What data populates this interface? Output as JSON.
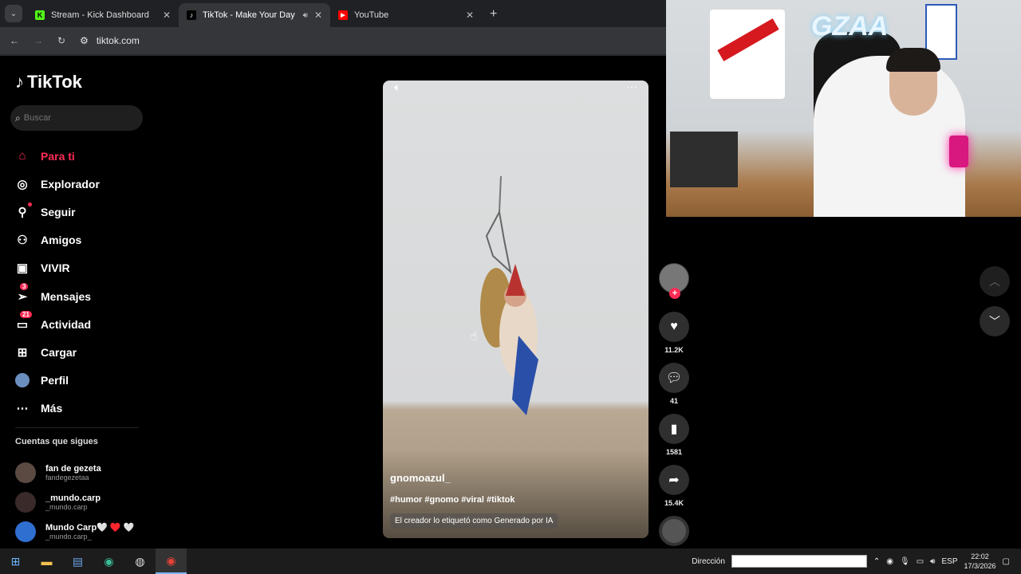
{
  "browser": {
    "tabs": [
      {
        "title": "Stream - Kick Dashboard",
        "favicon": "kick-icon",
        "active": false
      },
      {
        "title": "TikTok - Make Your Day",
        "favicon": "tiktok-icon",
        "active": true
      },
      {
        "title": "YouTube",
        "favicon": "youtube-icon",
        "active": false
      }
    ],
    "url": "tiktok.com"
  },
  "tiktok": {
    "logo_text": "TikTok",
    "search_placeholder": "Buscar",
    "nav": [
      {
        "label": "Para ti",
        "icon": "home-icon",
        "active": true
      },
      {
        "label": "Explorador",
        "icon": "compass-icon"
      },
      {
        "label": "Seguir",
        "icon": "follow-icon"
      },
      {
        "label": "Amigos",
        "icon": "friends-icon"
      },
      {
        "label": "VIVIR",
        "icon": "live-icon"
      },
      {
        "label": "Mensajes",
        "icon": "message-icon",
        "badge": "3"
      },
      {
        "label": "Actividad",
        "icon": "activity-icon",
        "badge": "21"
      },
      {
        "label": "Cargar",
        "icon": "upload-icon"
      },
      {
        "label": "Perfil",
        "icon": "profile-icon"
      },
      {
        "label": "Más",
        "icon": "more-icon"
      }
    ],
    "following_title": "Cuentas que sigues",
    "following": [
      {
        "name": "fan de gezeta",
        "handle": "fandegezetaa"
      },
      {
        "name": "_mundo.carp",
        "handle": "_mundo.carp"
      },
      {
        "name": "Mundo Carp🤍 ♥️ 🤍",
        "handle": "_mundo.carp_"
      }
    ],
    "video": {
      "username": "gnomoazul_",
      "tags": "#humor #gnomo #viral #tiktok",
      "ai_label": "El creador lo etiquetó como Generado por IA"
    },
    "actions": {
      "likes": "11.2K",
      "comments": "41",
      "saves": "1581",
      "shares": "15.4K"
    }
  },
  "webcam": {
    "neon_text": "GZAA"
  },
  "taskbar": {
    "direccion_label": "Dirección",
    "lang": "ESP",
    "time": "22:02",
    "date": "17/3/2026"
  }
}
